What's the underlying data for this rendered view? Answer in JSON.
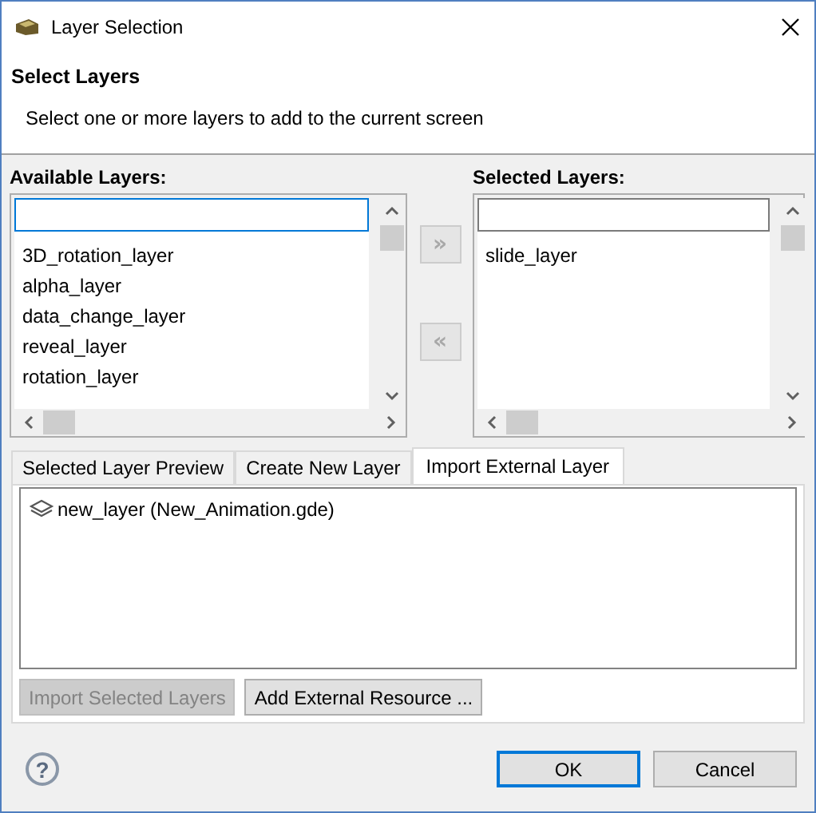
{
  "window": {
    "title": "Layer Selection"
  },
  "header": {
    "title": "Select Layers",
    "description": "Select one or more layers to add to the current screen"
  },
  "lists": [
    {
      "label": "Available Layers:",
      "focused": true,
      "items": [
        "3D_rotation_layer",
        "alpha_layer",
        "data_change_layer",
        "reveal_layer",
        "rotation_layer"
      ]
    },
    {
      "label": "Selected Layers:",
      "focused": false,
      "items": [
        "slide_layer"
      ]
    }
  ],
  "transfer_buttons": [
    {
      "label": "»",
      "disabled": true
    },
    {
      "label": "«",
      "disabled": true
    }
  ],
  "tabs": [
    {
      "label": "Selected Layer Preview",
      "selected": false
    },
    {
      "label": "Create New Layer",
      "selected": false
    },
    {
      "label": "Import External Layer",
      "selected": true
    }
  ],
  "import_list": {
    "items": [
      "new_layer (New_Animation.gde)"
    ]
  },
  "actions": [
    {
      "label": "Import Selected Layers",
      "disabled": true
    },
    {
      "label": "Add External Resource ...",
      "disabled": false
    }
  ],
  "footer": {
    "help": "?",
    "buttons": [
      {
        "label": "OK",
        "default": true
      },
      {
        "label": "Cancel",
        "default": false
      }
    ]
  }
}
